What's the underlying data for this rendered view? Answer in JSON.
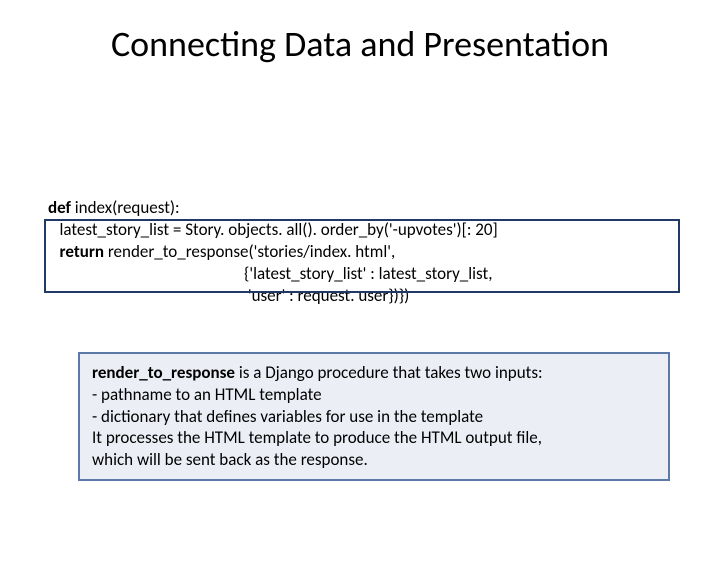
{
  "title": "Connecting Data and Presentation",
  "code": {
    "l1_kw": "def ",
    "l1_rest": "index(request):",
    "l2": "   latest_story_list = Story. objects. all(). order_by('-upvotes')[: 20]",
    "l3_kw": "   return ",
    "l3_rest": "render_to_response('stories/index. html',",
    "l4": "                                                   {'latest_story_list' : latest_story_list,",
    "l5": "                                                    'user' : request. user})})"
  },
  "expl": {
    "lead": "render_to_response",
    "after_lead": " is a Django procedure that takes two inputs:",
    "b1": "     - pathname to an HTML template",
    "b2": "     - dictionary that defines variables for use in the template",
    "p2a": "It processes the HTML template to produce the HTML output file,",
    "p2b": "which will be sent back as the response."
  }
}
